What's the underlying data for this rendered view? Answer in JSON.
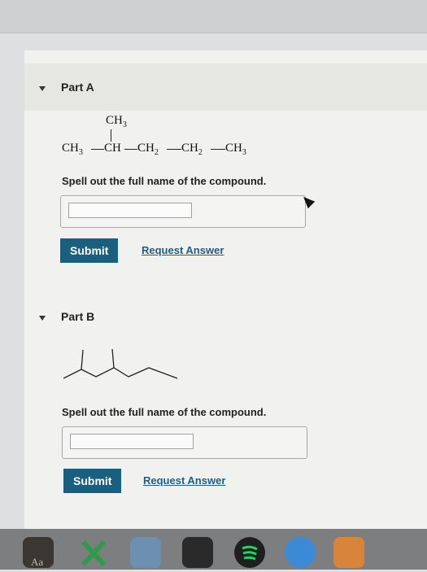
{
  "partA": {
    "title": "Part A",
    "formula": {
      "branch": "CH",
      "branch_sub": "3",
      "chain": [
        {
          "text": "CH",
          "sub": "3"
        },
        {
          "text": "CH",
          "sub": ""
        },
        {
          "text": "CH",
          "sub": "2"
        },
        {
          "text": "CH",
          "sub": "2"
        },
        {
          "text": "CH",
          "sub": "3"
        }
      ]
    },
    "prompt": "Spell out the full name of the compound.",
    "submit_label": "Submit",
    "request_label": "Request Answer"
  },
  "partB": {
    "title": "Part B",
    "prompt": "Spell out the full name of the compound.",
    "submit_label": "Submit",
    "request_label": "Request Answer"
  },
  "dock": {
    "aa_label": "Aa"
  }
}
